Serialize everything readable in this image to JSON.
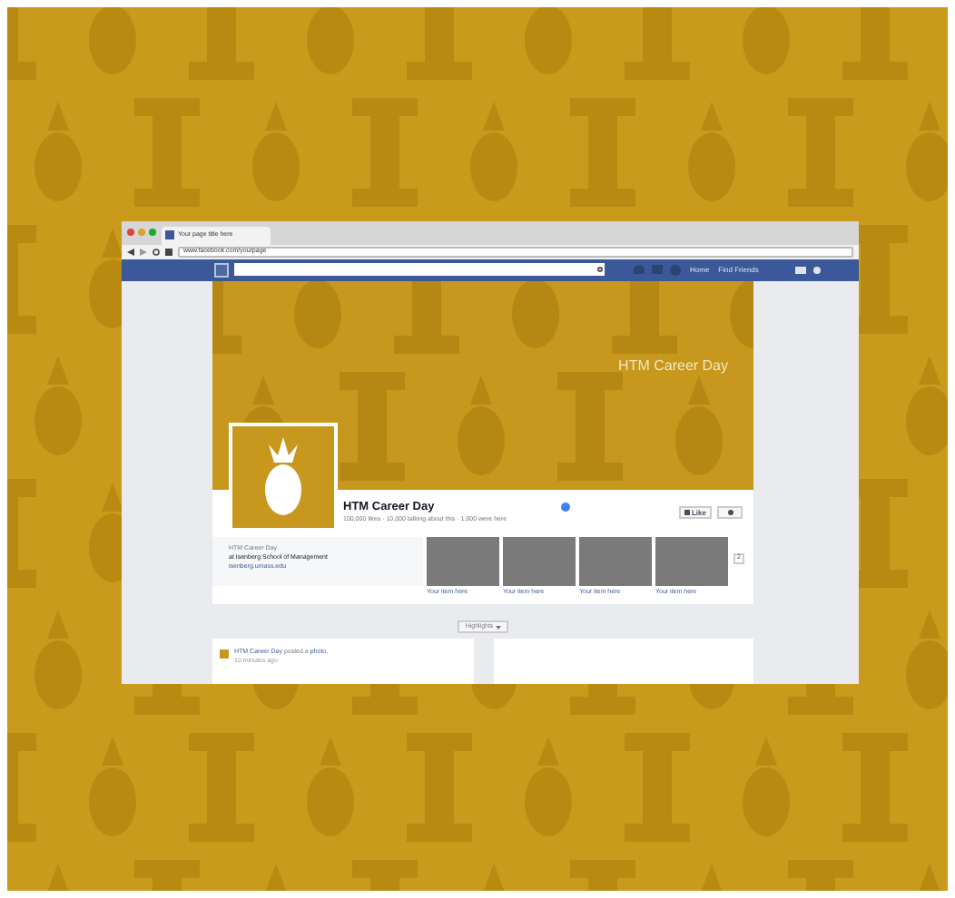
{
  "browser": {
    "tab_title": "Your page title here",
    "url": "www.facebook.com/yourpage"
  },
  "navbar": {
    "links": [
      "Home",
      "Find Friends"
    ]
  },
  "cover": {
    "title": "HTM Career Day"
  },
  "page": {
    "name": "HTM Career Day",
    "verified": true,
    "stats": "100,000 likes · 10,000 talking about this · 1,000 were here",
    "like_button": "Like"
  },
  "about": {
    "category": "HTM Career Day",
    "location": "at Isenberg School of Management",
    "link": "isenberg.umass.edu"
  },
  "tiles": [
    {
      "caption": "Your item here"
    },
    {
      "caption": "Your item here"
    },
    {
      "caption": "Your item here"
    },
    {
      "caption": "Your item here"
    }
  ],
  "more_button": "2",
  "timeline": {
    "highlights": "Highlights",
    "post": {
      "author": "HTM Career Day",
      "action": "posted a",
      "object": "photo.",
      "time": "10 minutes ago"
    }
  }
}
